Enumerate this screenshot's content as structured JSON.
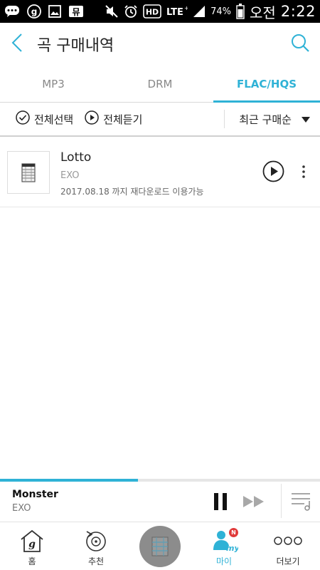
{
  "status_bar": {
    "battery": "74%",
    "ampm": "오전",
    "time": "2:22",
    "icons": [
      "message-icon",
      "g-app-icon",
      "gallery-icon",
      "music-icon",
      "mute-icon",
      "alarm-icon",
      "hd-icon",
      "lte-icon",
      "signal-icon",
      "battery-icon"
    ]
  },
  "header": {
    "title": "곡 구매내역",
    "back_icon": "back-icon",
    "search_icon": "search-icon"
  },
  "tabs": [
    {
      "label": "MP3",
      "active": false
    },
    {
      "label": "DRM",
      "active": false
    },
    {
      "label": "FLAC/HQS",
      "active": true
    }
  ],
  "toolbar": {
    "select_all": "전체선택",
    "play_all": "전체듣기",
    "sort": "최근 구매순"
  },
  "songs": [
    {
      "title": "Lotto",
      "artist": "EXO",
      "note": "2017.08.18 까지 재다운로드 이용가능"
    }
  ],
  "now_playing": {
    "title": "Monster",
    "artist": "EXO",
    "progress": 0.43
  },
  "bottom_nav": [
    {
      "label": "홈",
      "icon": "home-icon"
    },
    {
      "label": "추천",
      "icon": "recommend-icon"
    },
    {
      "label": "",
      "icon": "album-disc-icon"
    },
    {
      "label": "마이",
      "icon": "my-icon",
      "badge": "N",
      "active": true
    },
    {
      "label": "더보기",
      "icon": "more-icon"
    }
  ],
  "colors": {
    "accent": "#2fb2d6",
    "badge": "#e03a3a"
  }
}
